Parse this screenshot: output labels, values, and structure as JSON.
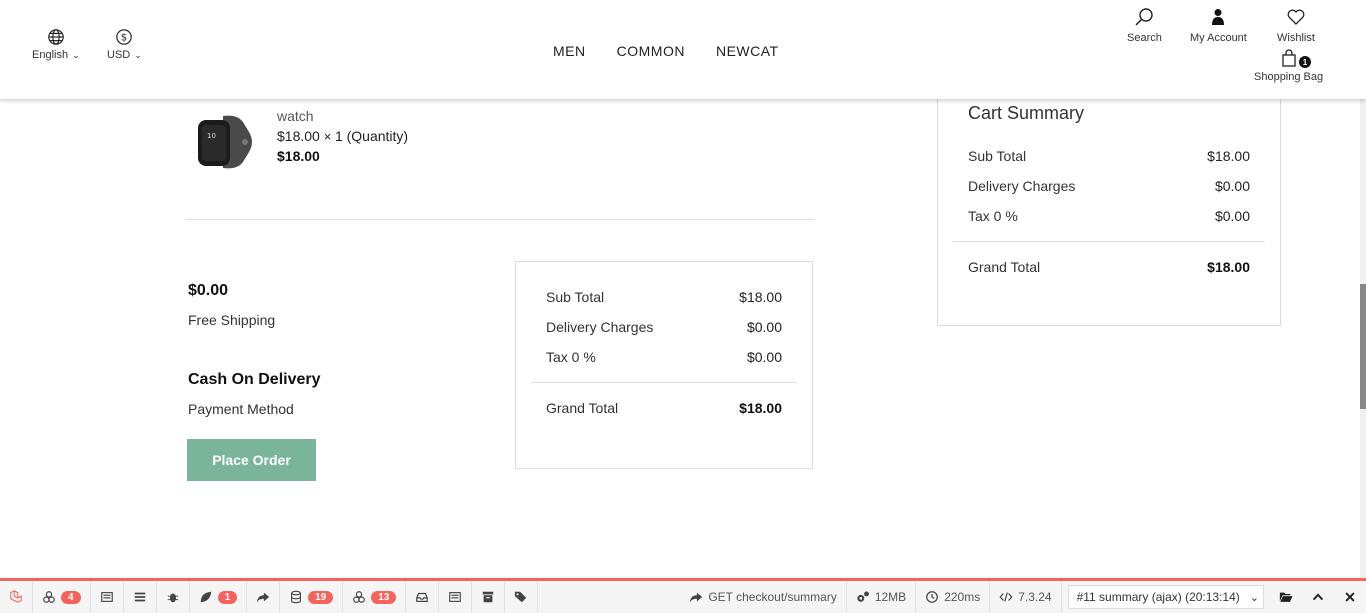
{
  "header": {
    "language": "English",
    "currency": "USD",
    "nav": [
      "MEN",
      "COMMON",
      "NEWCAT"
    ],
    "search_label": "Search",
    "account_label": "My Account",
    "wishlist_label": "Wishlist",
    "bag_label": "Shopping Bag",
    "bag_count": "1"
  },
  "product": {
    "name": "watch",
    "price_unit": "$18.00",
    "qty_text": "1 (Quantity)",
    "total": "$18.00"
  },
  "shipping": {
    "amount": "$0.00",
    "label": "Free Shipping"
  },
  "payment": {
    "method": "Cash On Delivery",
    "label": "Payment Method"
  },
  "place_order_label": "Place Order",
  "summary": {
    "sub_total_label": "Sub Total",
    "sub_total": "$18.00",
    "delivery_label": "Delivery Charges",
    "delivery": "$0.00",
    "tax_label": "Tax 0 %",
    "tax": "$0.00",
    "grand_label": "Grand Total",
    "grand": "$18.00"
  },
  "cart_summary": {
    "title": "Cart Summary",
    "sub_total_label": "Sub Total",
    "sub_total": "$18.00",
    "delivery_label": "Delivery Charges",
    "delivery": "$0.00",
    "tax_label": "Tax 0 %",
    "tax": "$0.00",
    "grand_label": "Grand Total",
    "grand": "$18.00"
  },
  "debugbar": {
    "accent": "#f4645f",
    "badge_views": "4",
    "badge_routes": "1",
    "badge_queries": "19",
    "badge_models": "13",
    "request": "GET checkout/summary",
    "memory": "12MB",
    "time": "220ms",
    "php": "7.3.24",
    "selected_request": "#11 summary (ajax) (20:13:14)"
  }
}
